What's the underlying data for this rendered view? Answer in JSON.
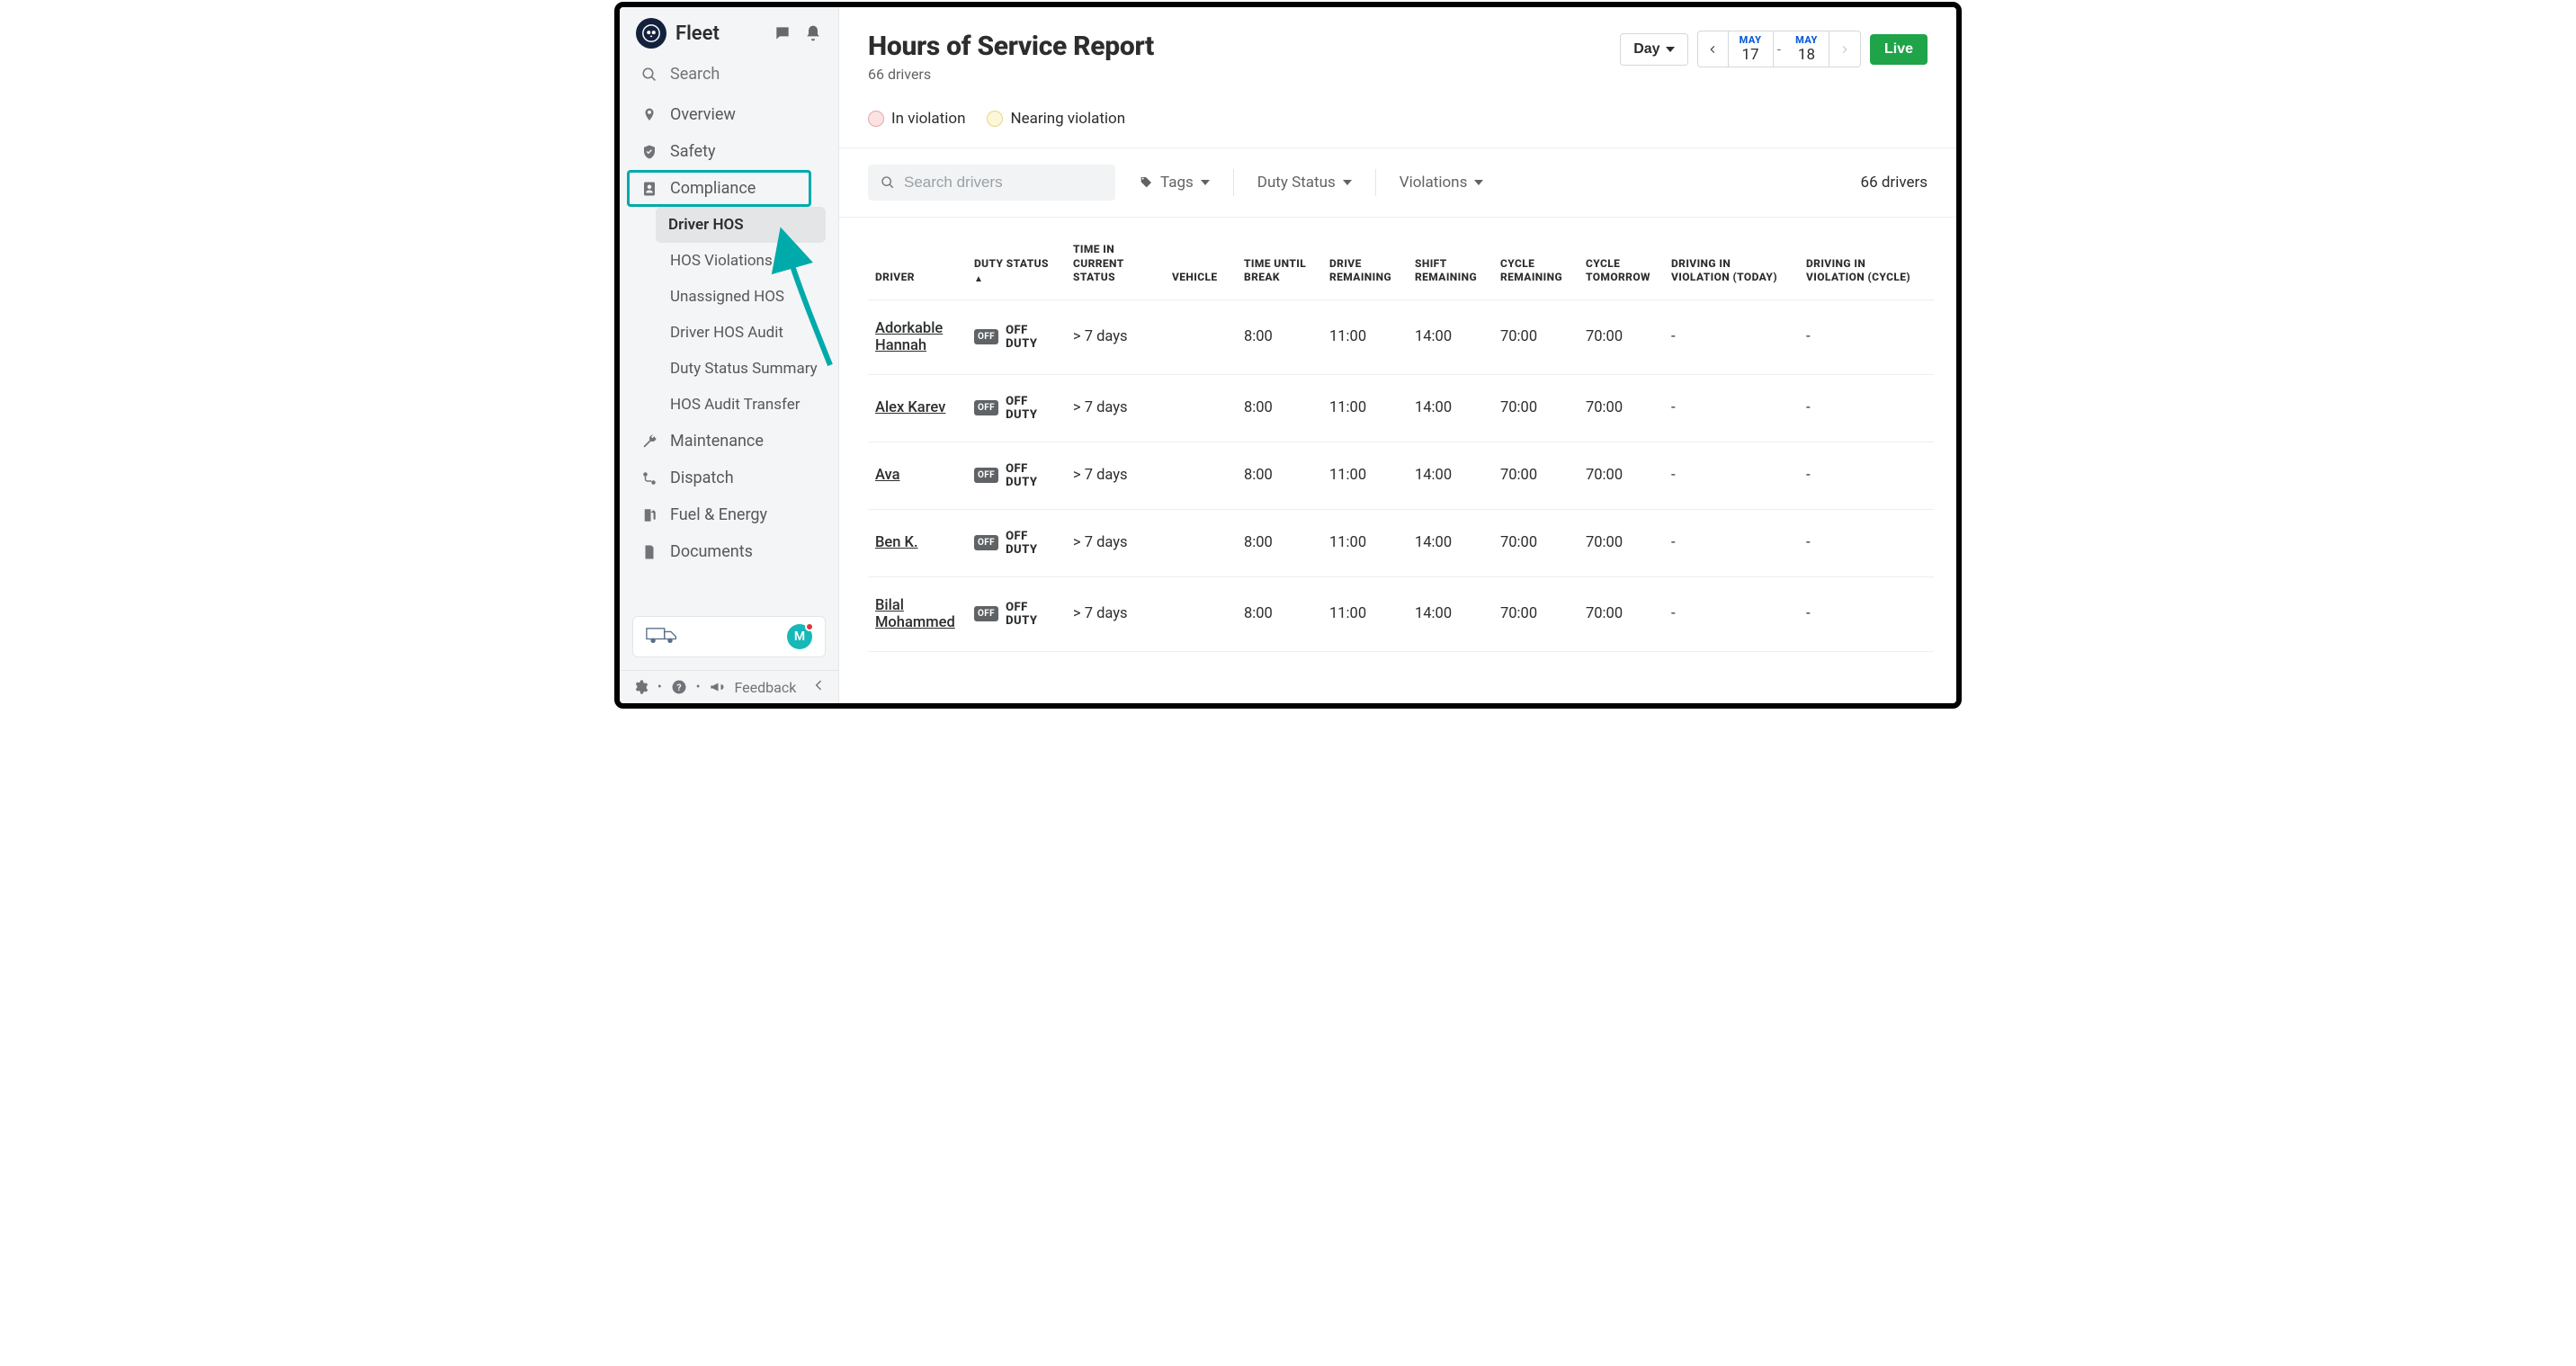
{
  "product": "Fleet",
  "searchLabel": "Search",
  "nav": {
    "overview": "Overview",
    "safety": "Safety",
    "compliance": "Compliance",
    "compliance_children": {
      "driver_hos": "Driver HOS",
      "hos_violations": "HOS Violations",
      "unassigned_hos": "Unassigned HOS",
      "driver_hos_audit": "Driver HOS Audit",
      "duty_status_summary": "Duty Status Summary",
      "hos_audit_transfer": "HOS Audit Transfer"
    },
    "maintenance": "Maintenance",
    "dispatch": "Dispatch",
    "fuel_energy": "Fuel & Energy",
    "documents": "Documents"
  },
  "avatarInitial": "M",
  "footerFeedback": "Feedback",
  "page": {
    "title": "Hours of Service Report",
    "subtitle": "66 drivers",
    "periodLabel": "Day",
    "date_from_month": "MAY",
    "date_from_day": "17",
    "date_to_month": "MAY",
    "date_to_day": "18",
    "liveLabel": "Live"
  },
  "legend": {
    "in_violation": "In violation",
    "nearing": "Nearing violation"
  },
  "filters": {
    "searchPlaceholder": "Search drivers",
    "tags": "Tags",
    "duty_status": "Duty Status",
    "violations": "Violations",
    "count": "66 drivers"
  },
  "table": {
    "headers": {
      "driver": "DRIVER",
      "duty_status": "DUTY STATUS",
      "sort_ind": "▲",
      "time_in_status": "TIME IN CURRENT STATUS",
      "vehicle": "VEHICLE",
      "time_until_break": "TIME UNTIL BREAK",
      "drive_remaining": "DRIVE REMAINING",
      "shift_remaining": "SHIFT REMAINING",
      "cycle_remaining": "CYCLE REMAINING",
      "cycle_tomorrow": "CYCLE TOMORROW",
      "driving_violation_today": "DRIVING IN VIOLATION (TODAY)",
      "driving_violation_cycle": "DRIVING IN VIOLATION (CYCLE)"
    },
    "duty_badge_off": "OFF",
    "duty_label_off": "OFF DUTY",
    "rows": [
      {
        "driver": "Adorkable Hannah",
        "time_status": "> 7 days",
        "vehicle": "",
        "break": "8:00",
        "drive": "11:00",
        "shift": "14:00",
        "cycle_rem": "70:00",
        "cycle_tom": "70:00",
        "v_today": "-",
        "v_cycle": "-"
      },
      {
        "driver": "Alex Karev",
        "time_status": "> 7 days",
        "vehicle": "",
        "break": "8:00",
        "drive": "11:00",
        "shift": "14:00",
        "cycle_rem": "70:00",
        "cycle_tom": "70:00",
        "v_today": "-",
        "v_cycle": "-"
      },
      {
        "driver": "Ava",
        "time_status": "> 7 days",
        "vehicle": "",
        "break": "8:00",
        "drive": "11:00",
        "shift": "14:00",
        "cycle_rem": "70:00",
        "cycle_tom": "70:00",
        "v_today": "-",
        "v_cycle": "-"
      },
      {
        "driver": "Ben K.",
        "time_status": "> 7 days",
        "vehicle": "",
        "break": "8:00",
        "drive": "11:00",
        "shift": "14:00",
        "cycle_rem": "70:00",
        "cycle_tom": "70:00",
        "v_today": "-",
        "v_cycle": "-"
      },
      {
        "driver": "Bilal Mohammed",
        "time_status": "> 7 days",
        "vehicle": "",
        "break": "8:00",
        "drive": "11:00",
        "shift": "14:00",
        "cycle_rem": "70:00",
        "cycle_tom": "70:00",
        "v_today": "-",
        "v_cycle": "-"
      }
    ]
  }
}
